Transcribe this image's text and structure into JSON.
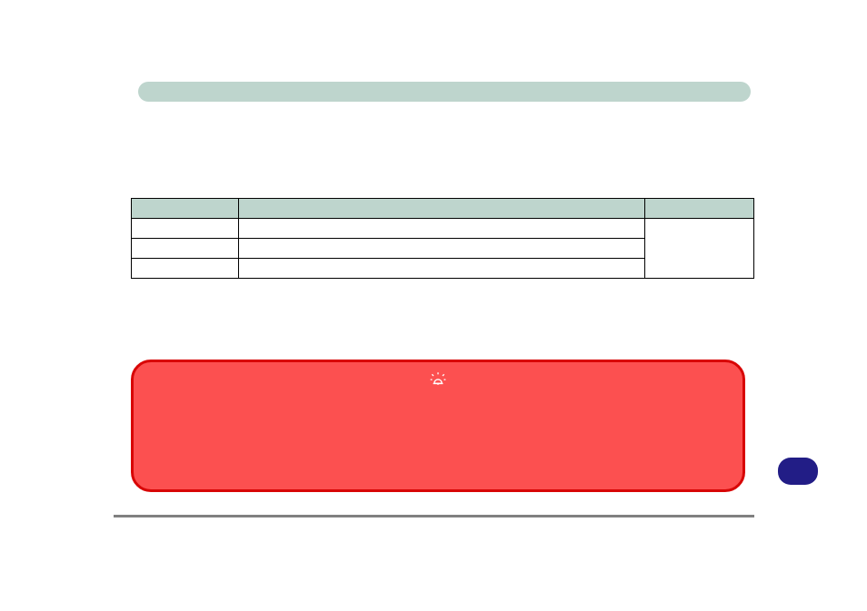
{
  "header": {
    "title": ""
  },
  "table": {
    "headers": [
      "",
      "",
      ""
    ],
    "rows": [
      {
        "a": "",
        "b": ""
      },
      {
        "a": "",
        "b": ""
      },
      {
        "a": "",
        "b": ""
      }
    ],
    "merged_right": ""
  },
  "alert": {
    "icon_name": "alarm-bell-icon",
    "text": ""
  },
  "side_button": {
    "label": ""
  }
}
